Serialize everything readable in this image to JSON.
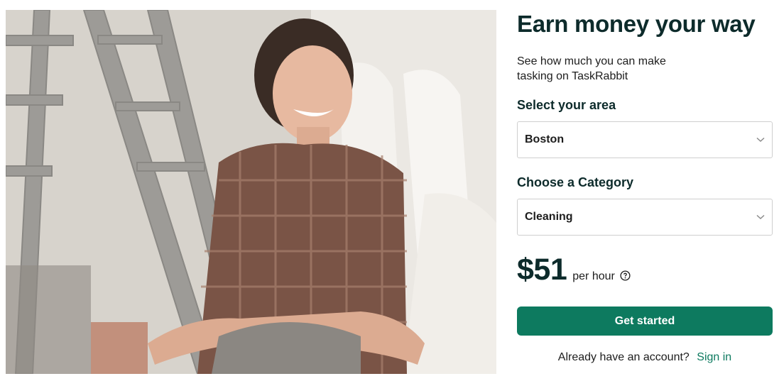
{
  "hero": {
    "image": "woman-in-plaid-shirt-with-ladder-photo"
  },
  "form": {
    "title": "Earn money your way",
    "subtitle": "See how much you can make tasking on TaskRabbit",
    "area_label": "Select your area",
    "area_value": "Boston",
    "category_label": "Choose a Category",
    "category_value": "Cleaning",
    "rate_amount": "$51",
    "rate_unit": "per hour",
    "cta_label": "Get started",
    "account_prompt": "Already have an account?",
    "signin_label": "Sign in"
  },
  "colors": {
    "brand_green": "#0d7a5f",
    "heading": "#0d2b2b"
  },
  "icons": {
    "select_chevron": "chevron-down-icon",
    "rate_help": "question-circle-icon"
  }
}
